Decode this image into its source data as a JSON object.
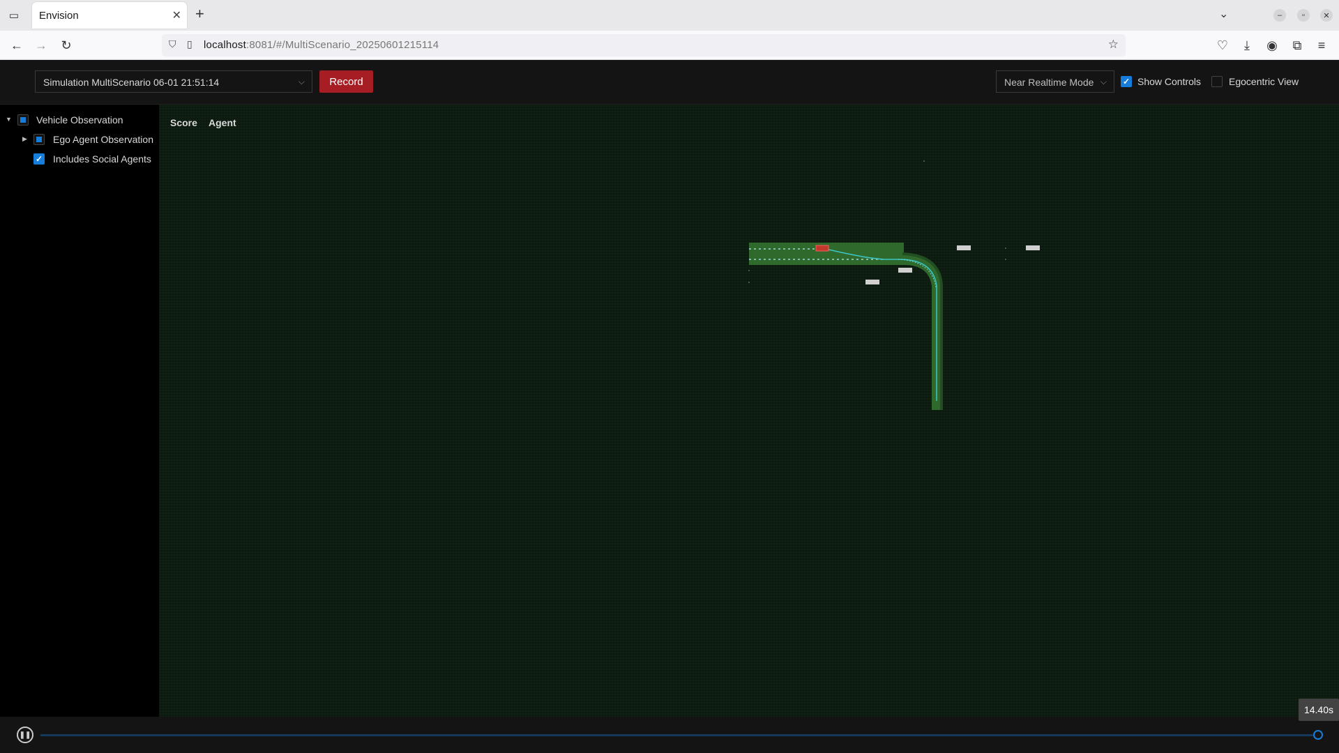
{
  "browser": {
    "tab_title": "Envision",
    "url_host": "localhost",
    "url_path": ":8081/#/MultiScenario_20250601215114"
  },
  "toolbar": {
    "simulation_select": "Simulation MultiScenario 06-01 21:51:14",
    "record_label": "Record",
    "mode_select": "Near Realtime Mode",
    "show_controls_label": "Show Controls",
    "show_controls_checked": true,
    "egocentric_label": "Egocentric View",
    "egocentric_checked": false
  },
  "sidebar": {
    "items": [
      {
        "label": "Vehicle Observation",
        "state": "indeterminate",
        "expanded": true
      },
      {
        "label": "Ego Agent Observation",
        "state": "indeterminate",
        "expanded": false
      },
      {
        "label": "Includes Social Agents",
        "state": "checked"
      }
    ]
  },
  "map": {
    "tabs": [
      {
        "label": "Score"
      },
      {
        "label": "Agent"
      }
    ],
    "colors": {
      "background": "#0c1a0f",
      "road": "#2f6a2c",
      "ego_vehicle": "#c0392b",
      "social_vehicle": "#d0d0d0",
      "lane_line": "#6fd6d6"
    }
  },
  "playback": {
    "time_label": "14.40s",
    "progress": 0.998
  },
  "icons": {
    "pause": "pause-icon",
    "back": "back-arrow-icon",
    "forward": "forward-arrow-icon",
    "reload": "reload-icon"
  }
}
